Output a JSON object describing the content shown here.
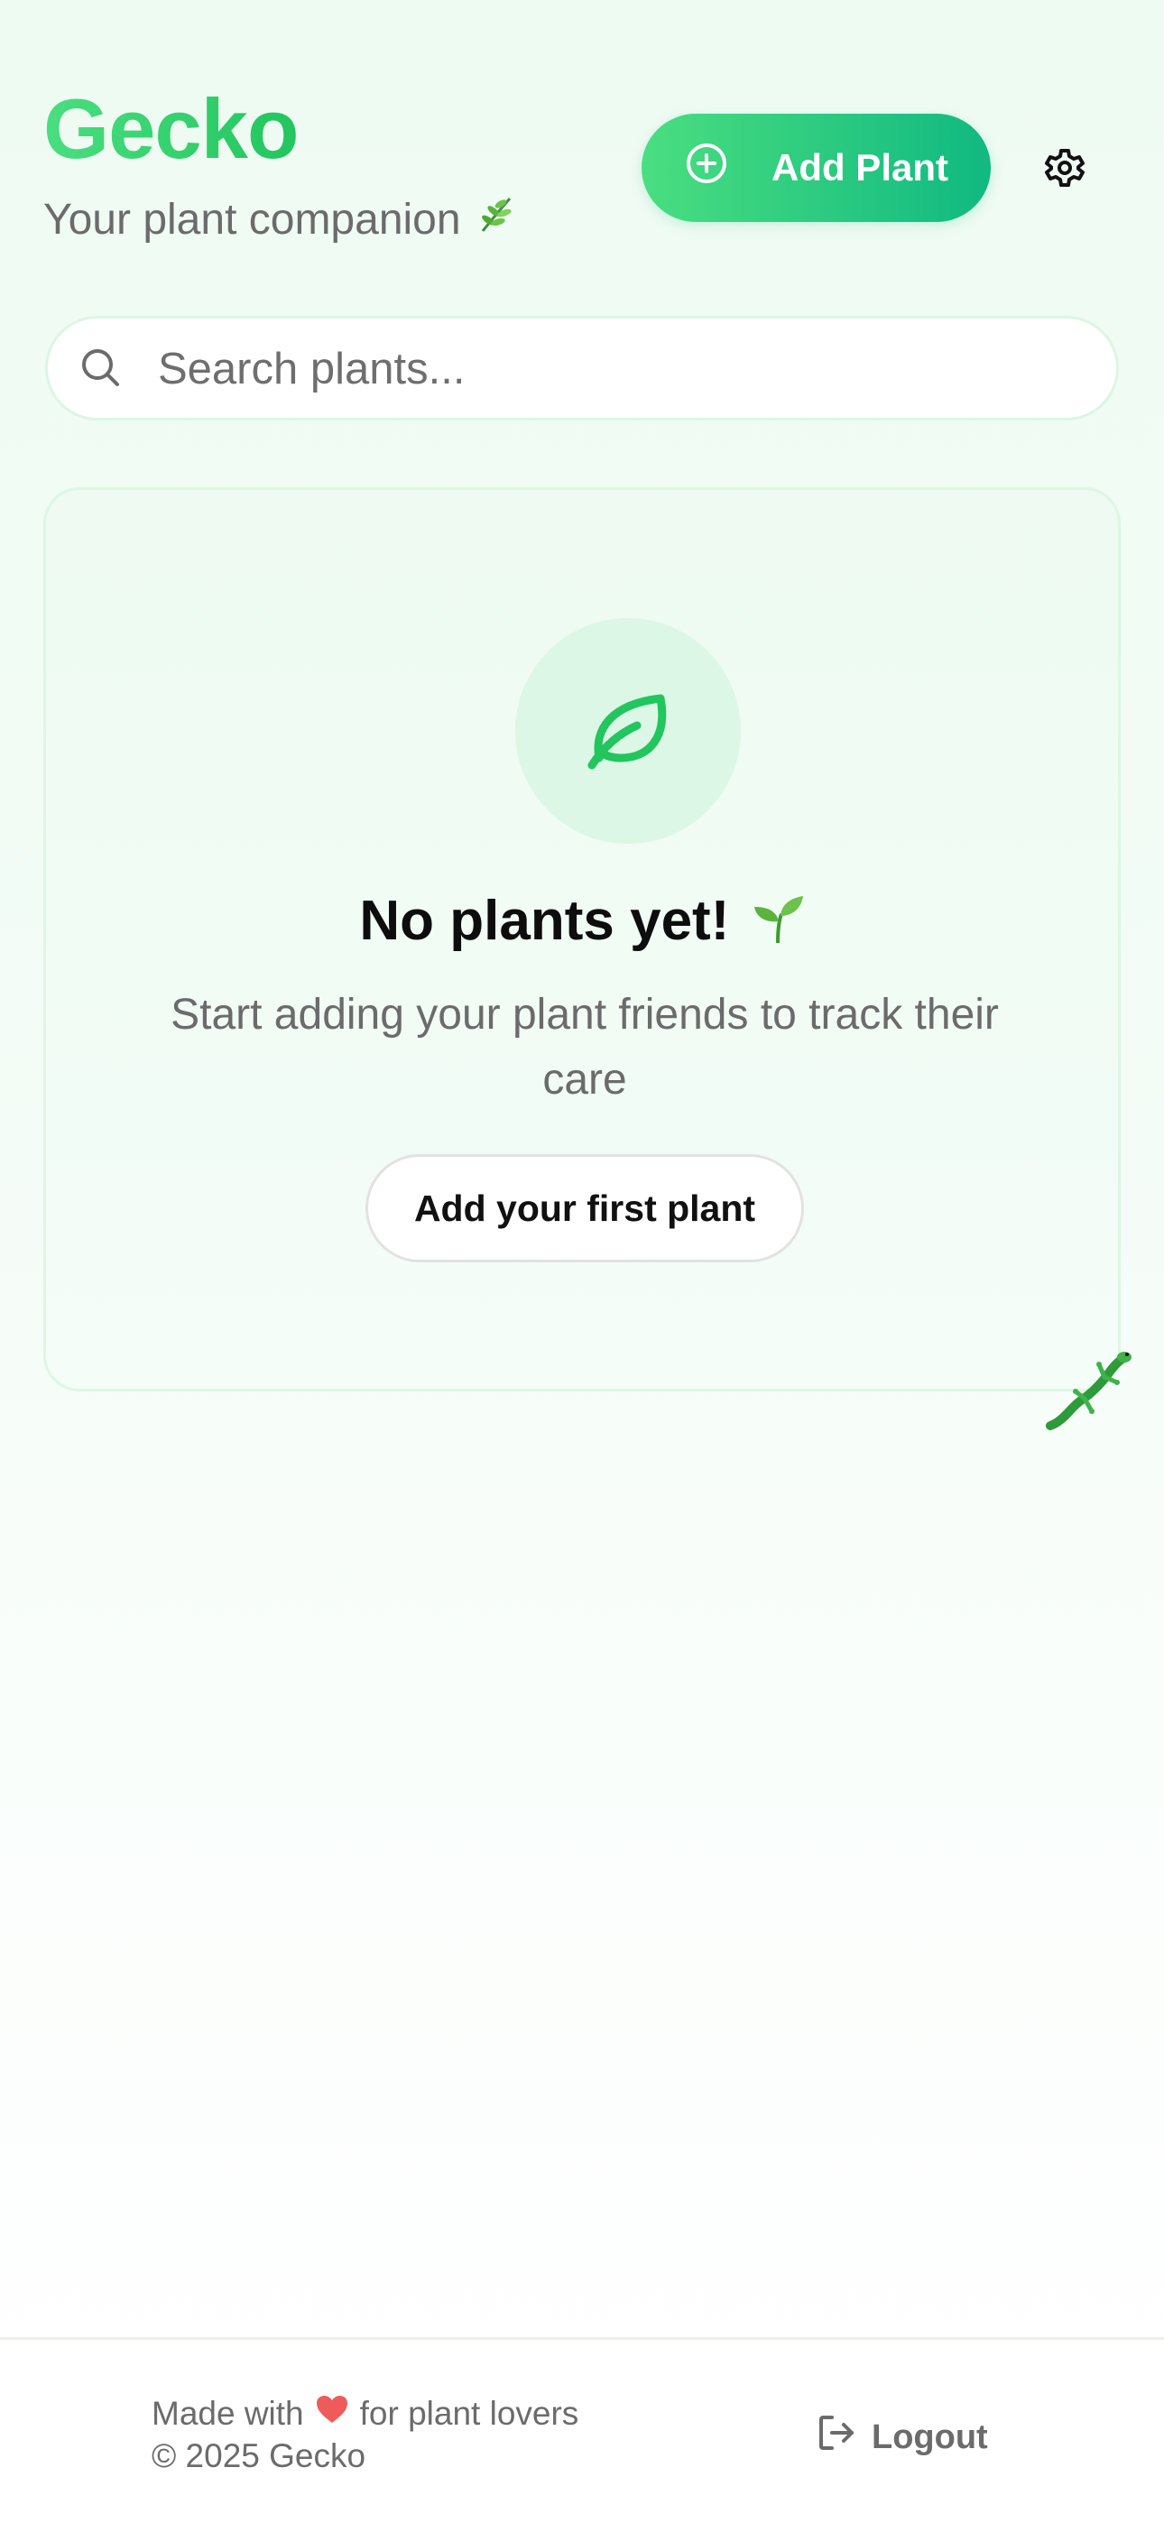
{
  "header": {
    "title": "Gecko",
    "subtitle": "Your plant companion",
    "subtitle_icon": "herb-icon",
    "add_button_label": "Add Plant",
    "add_button_icon": "plus-circle-icon",
    "settings_icon": "gear-icon"
  },
  "search": {
    "placeholder": "Search plants...",
    "value": "",
    "icon": "search-icon"
  },
  "empty_state": {
    "icon": "leaf-icon",
    "title": "No plants yet!",
    "title_icon": "seedling-icon",
    "description": "Start adding your plant friends to track their care",
    "button_label": "Add your first plant"
  },
  "mascot": {
    "icon": "lizard-icon"
  },
  "footer": {
    "made_with_prefix": "Made with",
    "made_with_suffix": "for plant lovers",
    "heart_icon": "heart-icon",
    "copyright": "© 2025 Gecko",
    "logout_label": "Logout",
    "logout_icon": "logout-icon"
  },
  "colors": {
    "brand_green": "#22c55e",
    "gradient_start": "#4ade80",
    "gradient_end": "#10b981",
    "heart": "#ef5b5b",
    "muted_text": "#6b6b6b"
  }
}
